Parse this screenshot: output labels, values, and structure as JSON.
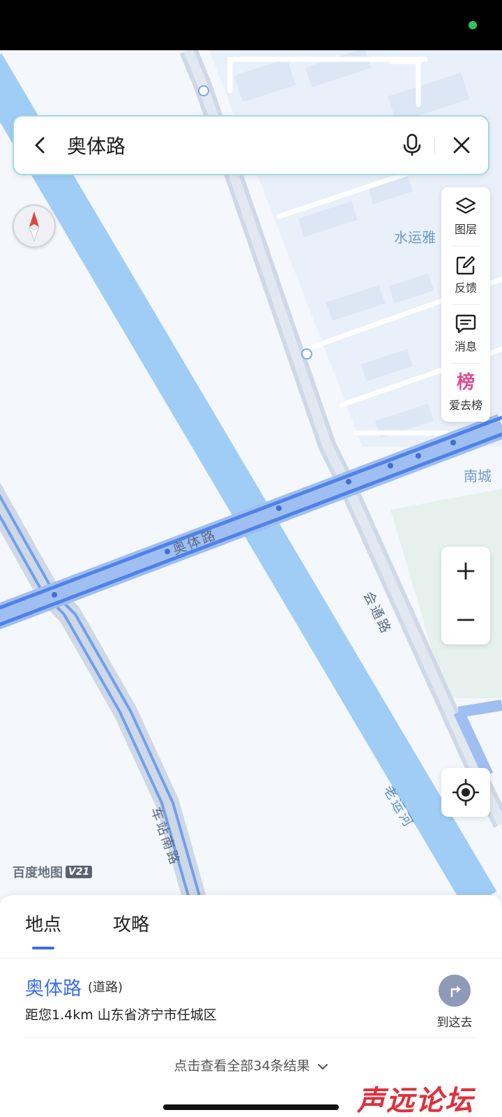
{
  "search": {
    "query": "奥体路"
  },
  "map": {
    "road_labels": {
      "aoti_road": "奥体路",
      "huitong_road": "会通路",
      "old_canal": "老运河",
      "station_south_road": "车站南路"
    },
    "poi_labels": {
      "shuiyun": "水运雅",
      "nancheng": "南城"
    },
    "brand": {
      "name": "百度地图",
      "version": "V21"
    }
  },
  "tools": [
    {
      "icon": "layers-icon",
      "label": "图层"
    },
    {
      "icon": "feedback-icon",
      "label": "反馈"
    },
    {
      "icon": "message-icon",
      "label": "消息"
    },
    {
      "icon": "ranking-icon",
      "glyph": "榜",
      "label": "爱去榜"
    }
  ],
  "zoom": {
    "in_glyph": "+",
    "out_glyph": "−"
  },
  "sheet": {
    "tabs": [
      {
        "label": "地点",
        "active": true
      },
      {
        "label": "攻略",
        "active": false
      }
    ],
    "result": {
      "name": "奥体路",
      "type": "(道路)",
      "address": "距您1.4km 山东省济宁市任城区",
      "goto_label": "到这去"
    },
    "more_label": "点击查看全部34条结果",
    "watermark": "声远论坛"
  },
  "colors": {
    "accent": "#3a6ee8",
    "river": "#9fcdf5",
    "road_highlight": "#5b8fe6",
    "status_dot": "#2ec45a"
  }
}
